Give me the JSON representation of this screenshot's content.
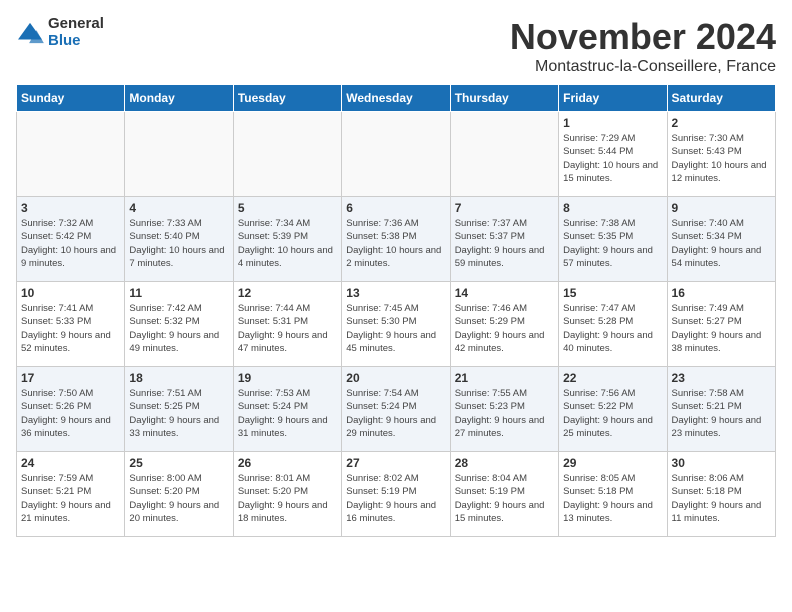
{
  "header": {
    "logo_general": "General",
    "logo_blue": "Blue",
    "month": "November 2024",
    "location": "Montastruc-la-Conseillere, France"
  },
  "columns": [
    "Sunday",
    "Monday",
    "Tuesday",
    "Wednesday",
    "Thursday",
    "Friday",
    "Saturday"
  ],
  "weeks": [
    [
      {
        "day": "",
        "info": ""
      },
      {
        "day": "",
        "info": ""
      },
      {
        "day": "",
        "info": ""
      },
      {
        "day": "",
        "info": ""
      },
      {
        "day": "",
        "info": ""
      },
      {
        "day": "1",
        "info": "Sunrise: 7:29 AM\nSunset: 5:44 PM\nDaylight: 10 hours and 15 minutes."
      },
      {
        "day": "2",
        "info": "Sunrise: 7:30 AM\nSunset: 5:43 PM\nDaylight: 10 hours and 12 minutes."
      }
    ],
    [
      {
        "day": "3",
        "info": "Sunrise: 7:32 AM\nSunset: 5:42 PM\nDaylight: 10 hours and 9 minutes."
      },
      {
        "day": "4",
        "info": "Sunrise: 7:33 AM\nSunset: 5:40 PM\nDaylight: 10 hours and 7 minutes."
      },
      {
        "day": "5",
        "info": "Sunrise: 7:34 AM\nSunset: 5:39 PM\nDaylight: 10 hours and 4 minutes."
      },
      {
        "day": "6",
        "info": "Sunrise: 7:36 AM\nSunset: 5:38 PM\nDaylight: 10 hours and 2 minutes."
      },
      {
        "day": "7",
        "info": "Sunrise: 7:37 AM\nSunset: 5:37 PM\nDaylight: 9 hours and 59 minutes."
      },
      {
        "day": "8",
        "info": "Sunrise: 7:38 AM\nSunset: 5:35 PM\nDaylight: 9 hours and 57 minutes."
      },
      {
        "day": "9",
        "info": "Sunrise: 7:40 AM\nSunset: 5:34 PM\nDaylight: 9 hours and 54 minutes."
      }
    ],
    [
      {
        "day": "10",
        "info": "Sunrise: 7:41 AM\nSunset: 5:33 PM\nDaylight: 9 hours and 52 minutes."
      },
      {
        "day": "11",
        "info": "Sunrise: 7:42 AM\nSunset: 5:32 PM\nDaylight: 9 hours and 49 minutes."
      },
      {
        "day": "12",
        "info": "Sunrise: 7:44 AM\nSunset: 5:31 PM\nDaylight: 9 hours and 47 minutes."
      },
      {
        "day": "13",
        "info": "Sunrise: 7:45 AM\nSunset: 5:30 PM\nDaylight: 9 hours and 45 minutes."
      },
      {
        "day": "14",
        "info": "Sunrise: 7:46 AM\nSunset: 5:29 PM\nDaylight: 9 hours and 42 minutes."
      },
      {
        "day": "15",
        "info": "Sunrise: 7:47 AM\nSunset: 5:28 PM\nDaylight: 9 hours and 40 minutes."
      },
      {
        "day": "16",
        "info": "Sunrise: 7:49 AM\nSunset: 5:27 PM\nDaylight: 9 hours and 38 minutes."
      }
    ],
    [
      {
        "day": "17",
        "info": "Sunrise: 7:50 AM\nSunset: 5:26 PM\nDaylight: 9 hours and 36 minutes."
      },
      {
        "day": "18",
        "info": "Sunrise: 7:51 AM\nSunset: 5:25 PM\nDaylight: 9 hours and 33 minutes."
      },
      {
        "day": "19",
        "info": "Sunrise: 7:53 AM\nSunset: 5:24 PM\nDaylight: 9 hours and 31 minutes."
      },
      {
        "day": "20",
        "info": "Sunrise: 7:54 AM\nSunset: 5:24 PM\nDaylight: 9 hours and 29 minutes."
      },
      {
        "day": "21",
        "info": "Sunrise: 7:55 AM\nSunset: 5:23 PM\nDaylight: 9 hours and 27 minutes."
      },
      {
        "day": "22",
        "info": "Sunrise: 7:56 AM\nSunset: 5:22 PM\nDaylight: 9 hours and 25 minutes."
      },
      {
        "day": "23",
        "info": "Sunrise: 7:58 AM\nSunset: 5:21 PM\nDaylight: 9 hours and 23 minutes."
      }
    ],
    [
      {
        "day": "24",
        "info": "Sunrise: 7:59 AM\nSunset: 5:21 PM\nDaylight: 9 hours and 21 minutes."
      },
      {
        "day": "25",
        "info": "Sunrise: 8:00 AM\nSunset: 5:20 PM\nDaylight: 9 hours and 20 minutes."
      },
      {
        "day": "26",
        "info": "Sunrise: 8:01 AM\nSunset: 5:20 PM\nDaylight: 9 hours and 18 minutes."
      },
      {
        "day": "27",
        "info": "Sunrise: 8:02 AM\nSunset: 5:19 PM\nDaylight: 9 hours and 16 minutes."
      },
      {
        "day": "28",
        "info": "Sunrise: 8:04 AM\nSunset: 5:19 PM\nDaylight: 9 hours and 15 minutes."
      },
      {
        "day": "29",
        "info": "Sunrise: 8:05 AM\nSunset: 5:18 PM\nDaylight: 9 hours and 13 minutes."
      },
      {
        "day": "30",
        "info": "Sunrise: 8:06 AM\nSunset: 5:18 PM\nDaylight: 9 hours and 11 minutes."
      }
    ]
  ]
}
